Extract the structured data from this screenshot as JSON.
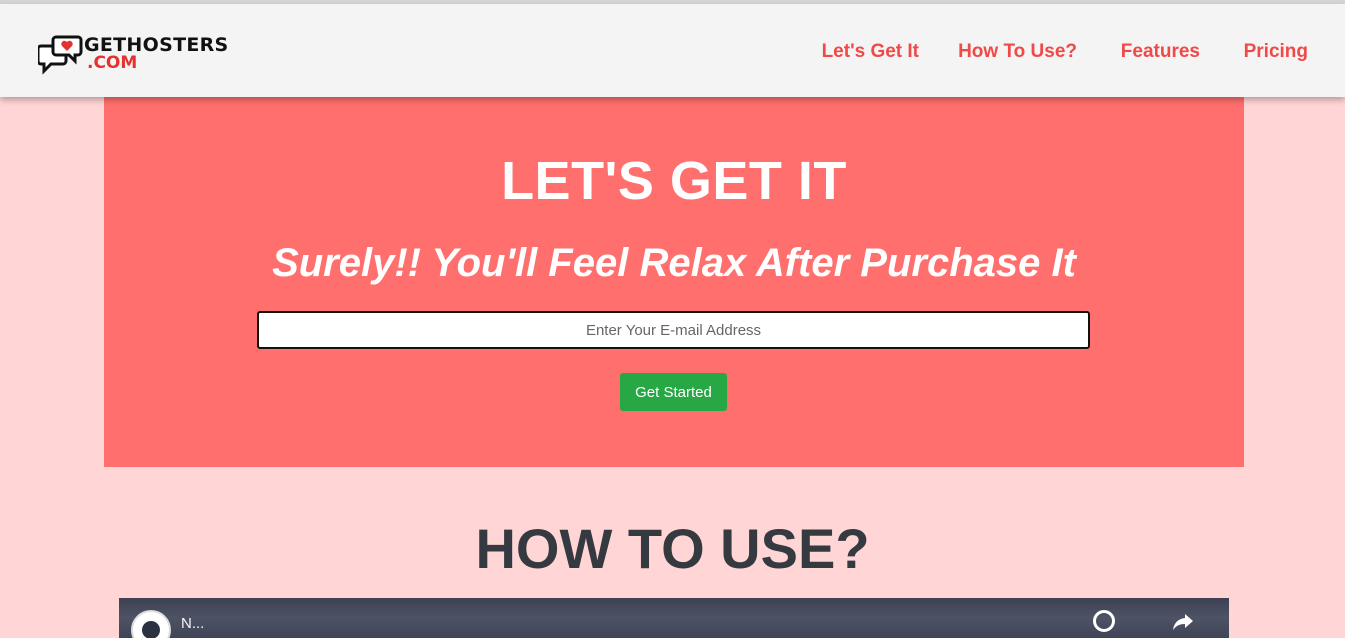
{
  "header": {
    "logo": {
      "line1": "GETHOSTERS",
      "line2": ".COM",
      "icon": "chat-bubbles-heart-icon"
    },
    "nav": [
      {
        "label": "Let's Get It"
      },
      {
        "label": "How To Use?"
      },
      {
        "label": "Features"
      },
      {
        "label": "Pricing"
      }
    ]
  },
  "hero": {
    "title": "LET'S GET IT",
    "subtitle": "Surely!! You'll Feel Relax After Purchase It",
    "email_placeholder": "Enter Your E-mail Address",
    "email_value": "",
    "button_label": "Get Started"
  },
  "how_to_use": {
    "title": "HOW TO USE?",
    "video": {
      "title": "N...",
      "icons": [
        "watch-later-icon",
        "share-icon"
      ]
    }
  },
  "colors": {
    "page_background": "#ffd5d6",
    "hero_background": "#ff6f6d",
    "nav_link": "#ef4a48",
    "button": "#28a745",
    "heading": "#343a40"
  }
}
